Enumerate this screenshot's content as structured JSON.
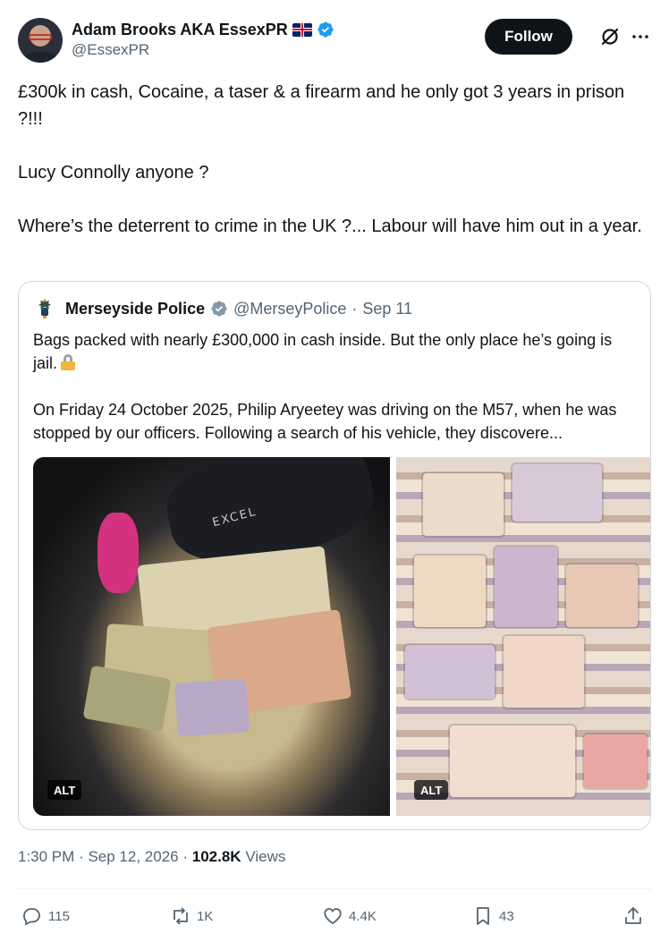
{
  "author": {
    "display_name": "Adam Brooks AKA EssexPR",
    "handle": "@EssexPR",
    "flag_icon": "uk-flag-icon",
    "verified_color": "#1d9bf0"
  },
  "header": {
    "follow_label": "Follow"
  },
  "tweet": {
    "paragraphs": [
      "£300k in cash, Cocaine, a taser & a firearm and he only got 3 years in prison ?!!!",
      "Lucy Connolly anyone ?",
      "Where’s the deterrent to crime in the UK ?... Labour will have him out in a year."
    ]
  },
  "quote": {
    "display_name": "Merseyside Police",
    "handle": "@MerseyPolice",
    "separator": "·",
    "date": "Sep 11",
    "verified_color": "#829aab",
    "paragraph1": "Bags packed with nearly £300,000 in cash inside. But the only place he’s going is jail.",
    "paragraph2": "On Friday 24 October 2025, Philip Aryeetey was driving on the M57, when he was stopped by our officers. Following a search of his vehicle, they discovere...",
    "images": [
      {
        "alt_badge": "ALT",
        "bag_label": "EXCEL"
      },
      {
        "alt_badge": "ALT"
      }
    ]
  },
  "meta": {
    "time": "1:30 PM",
    "separator": "·",
    "date": "Sep 12, 2026",
    "views_count": "102.8K",
    "views_label": "Views"
  },
  "actions": {
    "replies": "115",
    "reposts": "1K",
    "likes": "4.4K",
    "bookmarks": "43"
  }
}
